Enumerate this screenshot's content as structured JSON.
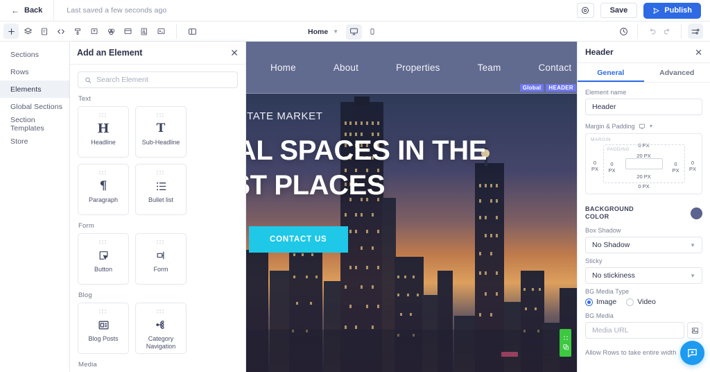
{
  "topbar": {
    "back_label": "Back",
    "saved_text": "Last saved a few seconds ago",
    "preview_icon": "eye-icon",
    "save_label": "Save",
    "publish_label": "Publish",
    "publish_icon": "send-icon",
    "publish_color": "#2d6ae3"
  },
  "toolbar": {
    "tools": [
      {
        "name": "add-element-icon",
        "glyph": "plus"
      },
      {
        "name": "layers-icon",
        "glyph": "layers"
      },
      {
        "name": "page-icon",
        "glyph": "page"
      },
      {
        "name": "code-icon",
        "glyph": "code"
      },
      {
        "name": "theme-icon",
        "glyph": "theme"
      },
      {
        "name": "text-box-icon",
        "glyph": "textbox"
      },
      {
        "name": "color-palette-icon",
        "glyph": "palette"
      },
      {
        "name": "card-icon",
        "glyph": "card"
      },
      {
        "name": "seo-icon",
        "glyph": "seo"
      },
      {
        "name": "console-icon",
        "glyph": "console"
      }
    ],
    "split_icon": "split-view-icon",
    "page_name": "Home",
    "viewport_desktop": "desktop-icon",
    "viewport_mobile": "mobile-icon",
    "history_icon": "history-icon",
    "undo_icon": "undo-icon",
    "redo_icon": "redo-icon",
    "settings_icon": "settings-sliders-icon"
  },
  "leftnav": {
    "items": [
      {
        "label": "Sections",
        "active": false
      },
      {
        "label": "Rows",
        "active": false
      },
      {
        "label": "Elements",
        "active": true
      },
      {
        "label": "Global Sections",
        "active": false
      },
      {
        "label": "Section Templates",
        "active": false
      },
      {
        "label": "Store",
        "active": false
      }
    ]
  },
  "elements_panel": {
    "title": "Add an Element",
    "close_icon": "close-icon",
    "search_placeholder": "Search Element",
    "search_value": "",
    "search_icon": "search-icon",
    "groups": [
      {
        "label": "Text",
        "items": [
          {
            "name": "Headline",
            "icon": "headline-icon",
            "glyph": "H"
          },
          {
            "name": "Sub-Headline",
            "icon": "sub-headline-icon",
            "glyph": "T"
          },
          {
            "name": "Paragraph",
            "icon": "paragraph-icon",
            "glyph": "¶"
          },
          {
            "name": "Bullet list",
            "icon": "bullet-list-icon",
            "glyph": "list"
          }
        ]
      },
      {
        "label": "Form",
        "items": [
          {
            "name": "Button",
            "icon": "button-icon",
            "glyph": "button"
          },
          {
            "name": "Form",
            "icon": "form-icon",
            "glyph": "form"
          }
        ]
      },
      {
        "label": "Blog",
        "items": [
          {
            "name": "Blog Posts",
            "icon": "blog-posts-icon",
            "glyph": "blogposts"
          },
          {
            "name": "Category Navigation",
            "icon": "category-navigation-icon",
            "glyph": "catnav"
          }
        ]
      },
      {
        "label": "Media",
        "items": []
      }
    ]
  },
  "canvas": {
    "header_bg": "#616a8f",
    "nav_items": [
      "Home",
      "About",
      "Properties",
      "Team",
      "Contact"
    ],
    "badges": [
      "Global",
      "HEADER"
    ],
    "badge_color": "#6e77ec",
    "hero_kicker": "EXPLORE THE REAL ESTATE MARKET",
    "hero_title_line1": "FIND IDEAL SPACES IN THE",
    "hero_title_line2": "GREATEST PLACES",
    "hero_cta": "CONTACT US",
    "hero_cta_color": "#1ec8e6",
    "green_widget_icon": "duplicate-icon"
  },
  "right_panel": {
    "title": "Header",
    "close_icon": "close-icon",
    "tabs": [
      {
        "label": "General",
        "active": true
      },
      {
        "label": "Advanced",
        "active": false
      }
    ],
    "element_name_label": "Element name",
    "element_name_value": "Header",
    "margin_padding_label": "Margin & Padding",
    "margin_padding_device_icon": "desktop-icon",
    "margin_padding_chevron": "chevron-down-icon",
    "margin_tag": "MARGIN",
    "padding_tag": "PADDING",
    "margin_top": "0 PX",
    "margin_right": "0\nPX",
    "margin_bottom": "0 PX",
    "margin_left": "0\nPX",
    "padding_top": "20 PX",
    "padding_right": "0\nPX",
    "padding_bottom": "20 PX",
    "padding_left": "0\nPX",
    "background_color_label": "BACKGROUND COLOR",
    "background_color_value": "#5b6490",
    "box_shadow_label": "Box Shadow",
    "box_shadow_value": "No Shadow",
    "sticky_label": "Sticky",
    "sticky_value": "No stickiness",
    "bg_media_type_label": "BG Media Type",
    "bg_media_type_options": [
      "Image",
      "Video"
    ],
    "bg_media_type_selected": "Image",
    "bg_media_label": "BG Media",
    "bg_media_placeholder": "Media URL",
    "bg_media_value": "",
    "bg_media_browse_icon": "image-picker-icon",
    "allow_rows_label": "Allow Rows to take entire width",
    "allow_rows_on": false,
    "chat_icon": "chat-bubble-icon"
  }
}
